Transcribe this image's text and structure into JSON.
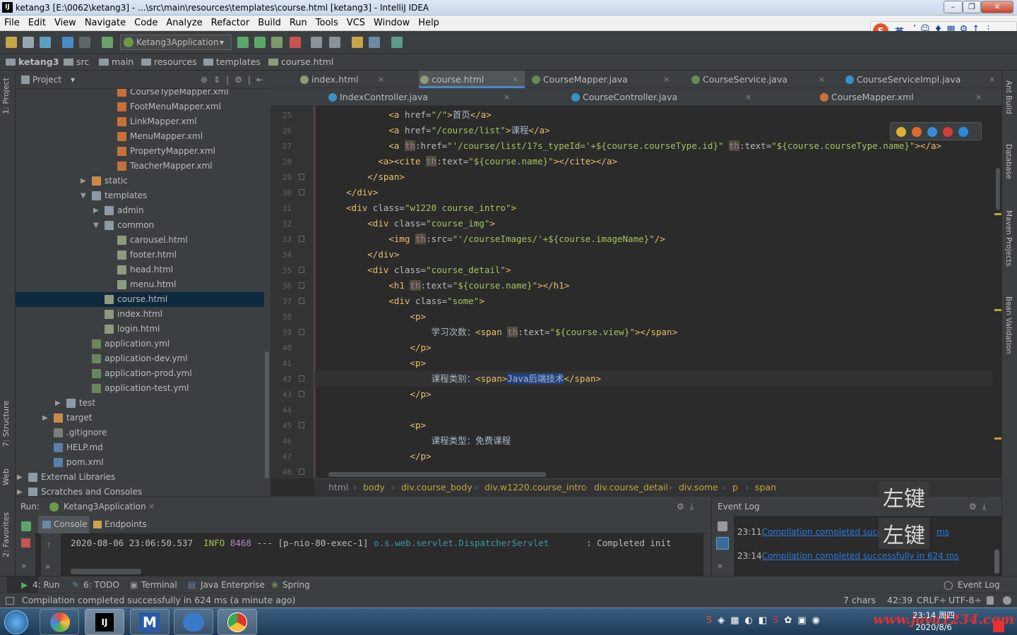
{
  "window": {
    "title": "ketang3 [E:\\0062\\ketang3] - ...\\src\\main\\resources\\templates\\course.html [ketang3] - IntelliJ IDEA",
    "app_icon": "IJ"
  },
  "menu": [
    "File",
    "Edit",
    "View",
    "Navigate",
    "Code",
    "Analyze",
    "Refactor",
    "Build",
    "Run",
    "Tools",
    "VCS",
    "Window",
    "Help"
  ],
  "ime": {
    "label": "英"
  },
  "toolbar": {
    "run_config": "Ketang3Application"
  },
  "breadcrumbs": [
    "ketang3",
    "src",
    "main",
    "resources",
    "templates",
    "course.html"
  ],
  "project": {
    "title": "Project",
    "tree": [
      {
        "label": "CourseTypeMapper.xml",
        "indent": 7,
        "type": "xml"
      },
      {
        "label": "FootMenuMapper.xml",
        "indent": 7,
        "type": "xml"
      },
      {
        "label": "LinkMapper.xml",
        "indent": 7,
        "type": "xml"
      },
      {
        "label": "MenuMapper.xml",
        "indent": 7,
        "type": "xml"
      },
      {
        "label": "PropertyMapper.xml",
        "indent": 7,
        "type": "xml"
      },
      {
        "label": "TeacherMapper.xml",
        "indent": 7,
        "type": "xml"
      },
      {
        "label": "static",
        "indent": 5,
        "type": "foldo",
        "arrow": "▶"
      },
      {
        "label": "templates",
        "indent": 5,
        "type": "fold",
        "arrow": "▼"
      },
      {
        "label": "admin",
        "indent": 6,
        "type": "fold",
        "arrow": "▶"
      },
      {
        "label": "common",
        "indent": 6,
        "type": "fold",
        "arrow": "▼"
      },
      {
        "label": "carousel.html",
        "indent": 7,
        "type": "html"
      },
      {
        "label": "footer.html",
        "indent": 7,
        "type": "html"
      },
      {
        "label": "head.html",
        "indent": 7,
        "type": "html"
      },
      {
        "label": "menu.html",
        "indent": 7,
        "type": "html"
      },
      {
        "label": "course.html",
        "indent": 6,
        "type": "html",
        "selected": true
      },
      {
        "label": "index.html",
        "indent": 6,
        "type": "html"
      },
      {
        "label": "login.html",
        "indent": 6,
        "type": "html"
      },
      {
        "label": "application.yml",
        "indent": 5,
        "type": "yml"
      },
      {
        "label": "application-dev.yml",
        "indent": 5,
        "type": "yml"
      },
      {
        "label": "application-prod.yml",
        "indent": 5,
        "type": "yml"
      },
      {
        "label": "application-test.yml",
        "indent": 5,
        "type": "yml"
      },
      {
        "label": "test",
        "indent": 3,
        "type": "fold",
        "arrow": "▶"
      },
      {
        "label": "target",
        "indent": 2,
        "type": "foldo",
        "arrow": "▶"
      },
      {
        "label": ".gitignore",
        "indent": 2,
        "type": "git"
      },
      {
        "label": "HELP.md",
        "indent": 2,
        "type": "md"
      },
      {
        "label": "pom.xml",
        "indent": 2,
        "type": "md"
      },
      {
        "label": "External Libraries",
        "indent": 0,
        "type": "fold",
        "arrow": "▶"
      },
      {
        "label": "Scratches and Consoles",
        "indent": 0,
        "type": "fold",
        "arrow": "▶"
      }
    ]
  },
  "tabs_row1": [
    {
      "label": "index.html",
      "color": "#8c9a7e"
    },
    {
      "label": "course.html",
      "color": "#8c9a7e",
      "active": true
    },
    {
      "label": "CourseMapper.java",
      "color": "#6a8759"
    },
    {
      "label": "CourseService.java",
      "color": "#6a8759"
    },
    {
      "label": "CourseServiceImpl.java",
      "color": "#3592c4"
    }
  ],
  "tabs_row2": [
    {
      "label": "IndexController.java",
      "color": "#3592c4"
    },
    {
      "label": "CourseController.java",
      "color": "#3592c4"
    },
    {
      "label": "CourseMapper.xml",
      "color": "#c8703a"
    }
  ],
  "code": {
    "lines": [
      {
        "n": "25",
        "html": "            <span class='tg'>&lt;a </span><span class='at'>href=</span><span class='st'>\"/\"</span><span class='tg'>&gt;</span><span class='tx2'>首页</span><span class='tg'>&lt;/a&gt;</span>"
      },
      {
        "n": "26",
        "html": "            <span class='tg'>&lt;a </span><span class='at'>href=</span><span class='st'>\"/course/list\"</span><span class='tg'>&gt;</span><span class='tx2'>课程</span><span class='tg'>&lt;/a&gt;</span>"
      },
      {
        "n": "27",
        "html": "            <span class='tg'>&lt;a </span><span class='ns'>th</span><span class='at'>:href=</span><span class='st'>\"'/course/list/1?s_typeId='+${course.courseType.id}\" </span><span class='ns'>th</span><span class='at'>:text=</span><span class='st'>\"${course.courseType.name}\"</span><span class='tg'>&gt;&lt;/a&gt;</span>"
      },
      {
        "n": "28",
        "html": "          <span class='tg'>&lt;a&gt;&lt;cite </span><span class='ns'>th</span><span class='at'>:text=</span><span class='st'>\"${course.name}\"</span><span class='tg'>&gt;&lt;/cite&gt;&lt;/a&gt;</span>"
      },
      {
        "n": "29",
        "html": "        <span class='tg'>&lt;/span&gt;</span>"
      },
      {
        "n": "30",
        "html": "    <span class='tg'>&lt;/div&gt;</span>"
      },
      {
        "n": "31",
        "html": "    <span class='tg'>&lt;div </span><span class='at'>class=</span><span class='st'>\"w1220 course_intro\"</span><span class='tg'>&gt;</span>"
      },
      {
        "n": "32",
        "html": "        <span class='tg'>&lt;div </span><span class='at'>class=</span><span class='st'>\"course_img\"</span><span class='tg'>&gt;</span>"
      },
      {
        "n": "33",
        "html": "            <span class='tg'>&lt;img </span><span class='ns'>th</span><span class='at'>:src=</span><span class='st'>\"'/courseImages/'+${course.imageName}\"</span><span class='tg'>/&gt;</span>"
      },
      {
        "n": "34",
        "html": "        <span class='tg'>&lt;/div&gt;</span>"
      },
      {
        "n": "35",
        "html": "        <span class='tg'>&lt;div </span><span class='at'>class=</span><span class='st'>\"course_detail\"</span><span class='tg'>&gt;</span>"
      },
      {
        "n": "36",
        "html": "            <span class='tg'>&lt;h1 </span><span class='ns'>th</span><span class='at'>:text=</span><span class='st'>\"${course.name}\"</span><span class='tg'>&gt;&lt;/h1&gt;</span>"
      },
      {
        "n": "37",
        "html": "            <span class='tg'>&lt;div </span><span class='at'>class=</span><span class='st'>\"some\"</span><span class='tg'>&gt;</span>"
      },
      {
        "n": "38",
        "html": "                <span class='tg'>&lt;p&gt;</span>"
      },
      {
        "n": "39",
        "html": "                    <span class='tx2'>学习次数：</span><span class='tg'>&lt;span </span><span class='ns'>th</span><span class='at'>:text=</span><span class='st'>\"${course.view}\"</span><span class='tg'>&gt;&lt;/span&gt;</span>"
      },
      {
        "n": "40",
        "html": "                <span class='tg'>&lt;/p&gt;</span>"
      },
      {
        "n": "41",
        "html": "                <span class='tg'>&lt;p&gt;</span>"
      },
      {
        "n": "42",
        "html": "                    <span class='tx2'>课程类别：</span><span class='tg'>&lt;span&gt;</span><span class='tx2' style='background:#214283'>Java后端技术</span><span class='tg'>&lt;/span&gt;</span>",
        "current": true
      },
      {
        "n": "43",
        "html": "                <span class='tg'>&lt;/p&gt;</span>"
      },
      {
        "n": "44",
        "html": ""
      },
      {
        "n": "45",
        "html": "                <span class='tg'>&lt;p&gt;</span>"
      },
      {
        "n": "46",
        "html": "                    <span class='tx2'>课程类型：免费课程</span>"
      },
      {
        "n": "47",
        "html": "                <span class='tg'>&lt;/p&gt;</span>"
      },
      {
        "n": "48",
        "html": ""
      }
    ]
  },
  "editor_breadcrumbs": [
    "html",
    "body",
    "div.course_body",
    "div.w1220.course_intro",
    "div.course_detail",
    "div.some",
    "p",
    "span"
  ],
  "run": {
    "label": "Run:",
    "config": "Ketang3Application",
    "tabs": [
      "Console",
      "Endpoints"
    ],
    "console_line": {
      "ts": "2020-08-06 23:06:50.537",
      "level": "INFO",
      "pid": "8468",
      "sep": "---",
      "thread": "[p-nio-80-exec-1]",
      "logger": "o.s.web.servlet.DispatcherServlet",
      "msg": ": Completed init"
    }
  },
  "event_log": {
    "title": "Event Log",
    "entries": [
      {
        "time": "23:11",
        "text": "Compilation completed succ",
        "suffix": "ms"
      },
      {
        "time": "23:14",
        "text": "Compilation completed successfully in 624 ms"
      }
    ],
    "overlay1": "左键",
    "overlay2": "左键"
  },
  "tool_tabs": {
    "run": "4: Run",
    "todo": "6: TODO",
    "terminal": "Terminal",
    "javaee": "Java Enterprise",
    "spring": "Spring",
    "eventlog": "Event Log"
  },
  "status": {
    "message": "Compilation completed successfully in 624 ms (a minute ago)",
    "chars": "7 chars",
    "position": "42:39",
    "line_sep": "CRLF÷",
    "encoding": "UTF-8÷"
  },
  "side_tabs_left": [
    "1: Project",
    "7: Structure",
    "Web",
    "2: Favorites"
  ],
  "side_tabs_right": [
    "Ant Build",
    "Database",
    "Maven Projects",
    "Bean Validation"
  ],
  "taskbar": {
    "time": "23:14 周四",
    "date": "2020/8/6",
    "watermark": "www.java1234.com"
  }
}
